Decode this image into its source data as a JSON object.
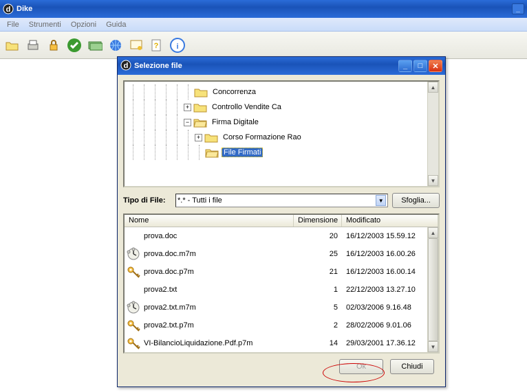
{
  "app": {
    "title": "Dike"
  },
  "menu": {
    "file": "File",
    "strumenti": "Strumenti",
    "opzioni": "Opzioni",
    "guida": "Guida"
  },
  "dialog": {
    "title": "Selezione file",
    "tree": {
      "items": [
        {
          "label": "Concorrenza"
        },
        {
          "label": "Controllo Vendite Ca"
        },
        {
          "label": "Firma Digitale"
        },
        {
          "label": "Corso Formazione Rao"
        },
        {
          "label": "File Firmati"
        }
      ]
    },
    "filetype_label": "Tipo di File:",
    "filetype_value": "*.*  - Tutti i file",
    "browse": "Sfoglia...",
    "list": {
      "headers": {
        "name": "Nome",
        "size": "Dimensione",
        "modified": "Modificato"
      },
      "rows": [
        {
          "icon": "blank",
          "name": "prova.doc",
          "size": "20",
          "modified": "16/12/2003 15.59.12"
        },
        {
          "icon": "clock",
          "name": "prova.doc.m7m",
          "size": "25",
          "modified": "16/12/2003 16.00.26"
        },
        {
          "icon": "key",
          "name": "prova.doc.p7m",
          "size": "21",
          "modified": "16/12/2003 16.00.14"
        },
        {
          "icon": "blank",
          "name": "prova2.txt",
          "size": "1",
          "modified": "22/12/2003 13.27.10"
        },
        {
          "icon": "clock",
          "name": "prova2.txt.m7m",
          "size": "5",
          "modified": "02/03/2006 9.16.48"
        },
        {
          "icon": "key",
          "name": "prova2.txt.p7m",
          "size": "2",
          "modified": "28/02/2006 9.01.06"
        },
        {
          "icon": "key",
          "name": "VI-BilancioLiquidazione.Pdf.p7m",
          "size": "14",
          "modified": "29/03/2001 17.36.12"
        }
      ]
    },
    "ok": "Ok",
    "close": "Chiudi"
  }
}
